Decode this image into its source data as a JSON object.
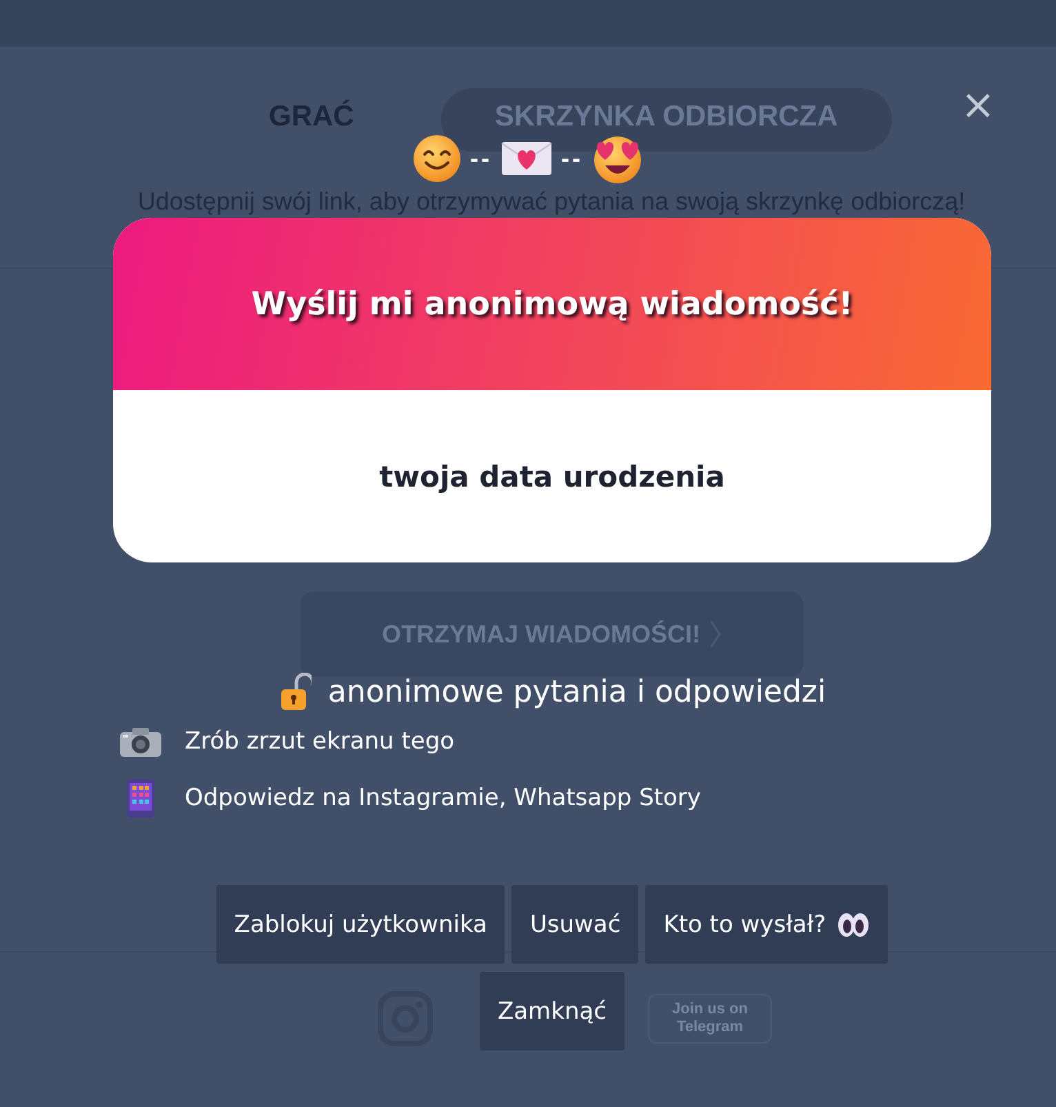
{
  "background": {
    "tabs": [
      {
        "label": "GRAĆ",
        "selected": false
      },
      {
        "label": "SKRZYNKA ODBIORCZA",
        "selected": true
      }
    ],
    "subtitle": "Udostępnij swój link, aby otrzymywać pytania na swoją skrzynkę odbiorczą!",
    "cta": "OTRZYMAJ WIADOMOŚCI!",
    "telegram": [
      "Join us on",
      "Telegram"
    ]
  },
  "modal": {
    "close": "×",
    "separators": [
      "--",
      "--"
    ],
    "card": {
      "title": "Wyślij mi anonimową wiadomość!",
      "question": "twoja data urodzenia"
    },
    "headline": "anonimowe pytania i odpowiedzi",
    "tips": [
      {
        "kind": "camera",
        "text": "Zrób zrzut ekranu tego"
      },
      {
        "kind": "phone",
        "text": "Odpowiedz na Instagramie, Whatsapp Story"
      }
    ],
    "buttons": [
      {
        "kind": "plain",
        "label": "Zablokuj użytkownika"
      },
      {
        "kind": "plain",
        "label": "Usuwać"
      },
      {
        "kind": "eyes",
        "label": "Kto to wysłał?"
      },
      {
        "kind": "plain",
        "label": "Zamknąć"
      }
    ]
  }
}
